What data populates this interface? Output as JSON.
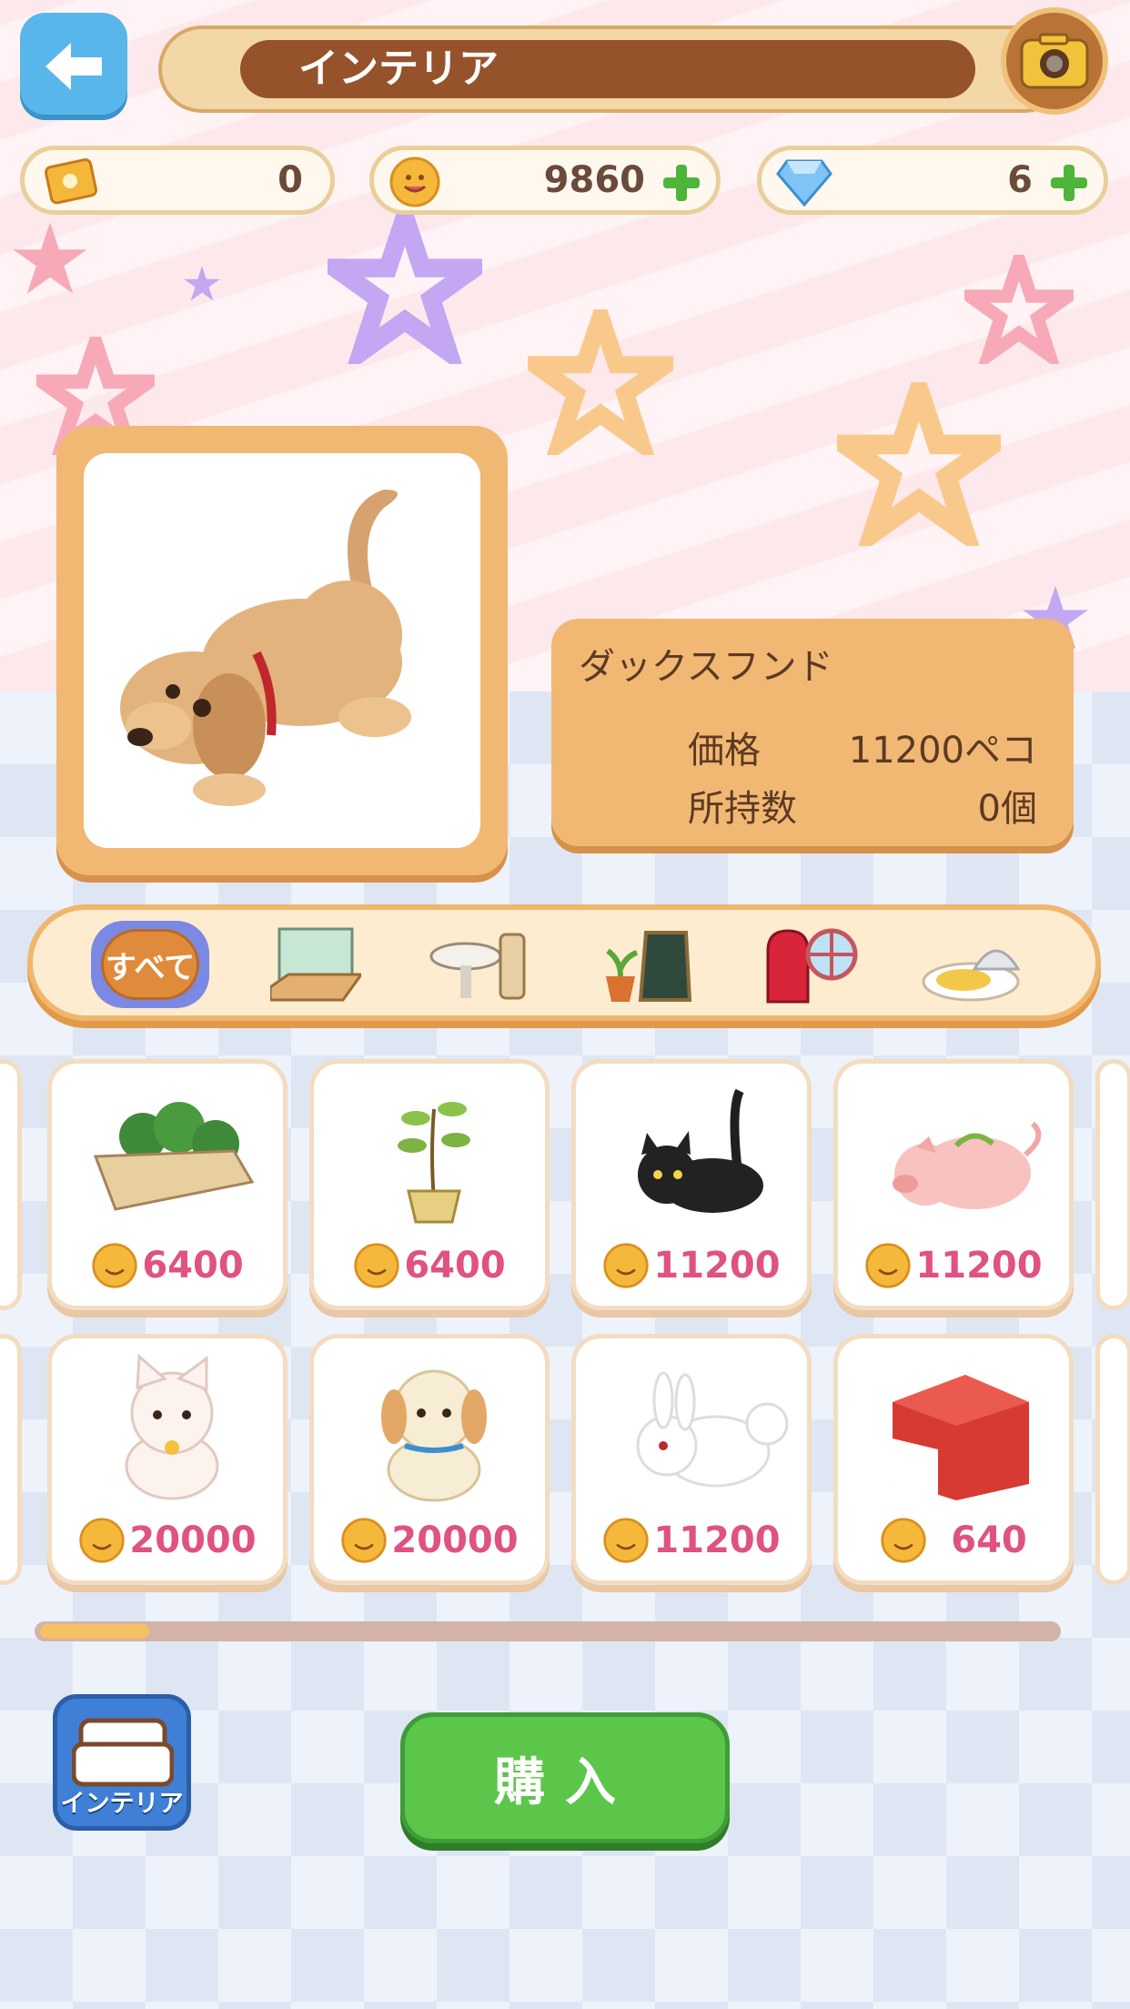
{
  "header": {
    "title": "インテリア",
    "back_icon": "back-arrow-icon",
    "camera_icon": "camera-icon"
  },
  "currencies": {
    "tickets": "0",
    "coins": "9860",
    "gems": "6"
  },
  "selected_item": {
    "name": "ダックスフンド",
    "price_label": "価格",
    "price_value": "11200ペコ",
    "owned_label": "所持数",
    "owned_value": "0個"
  },
  "categories": [
    {
      "label": "すべて",
      "icon": "all-category-icon",
      "selected": true
    },
    {
      "label": "",
      "icon": "wall-floor-category-icon"
    },
    {
      "label": "",
      "icon": "table-chair-category-icon"
    },
    {
      "label": "",
      "icon": "plant-sign-category-icon"
    },
    {
      "label": "",
      "icon": "door-window-category-icon"
    },
    {
      "label": "",
      "icon": "food-category-icon"
    }
  ],
  "items": [
    {
      "price": "6400",
      "icon": "planter-icon"
    },
    {
      "price": "6400",
      "icon": "potted-plant-icon"
    },
    {
      "price": "11200",
      "icon": "black-cat-icon"
    },
    {
      "price": "11200",
      "icon": "pig-icon"
    },
    {
      "price": "20000",
      "icon": "white-cat-plush-icon"
    },
    {
      "price": "20000",
      "icon": "puppy-plush-icon"
    },
    {
      "price": "11200",
      "icon": "rabbit-icon"
    },
    {
      "price": "640",
      "icon": "red-tent-icon"
    }
  ],
  "scroll": {
    "position": 0.05
  },
  "bottom": {
    "interior_label": "インテリア",
    "buy_label": "購入"
  },
  "colors": {
    "accent_green": "#5cc64a",
    "price_pink": "#e0527f",
    "panel_orange": "#f1b874",
    "back_blue": "#58b6ea"
  }
}
